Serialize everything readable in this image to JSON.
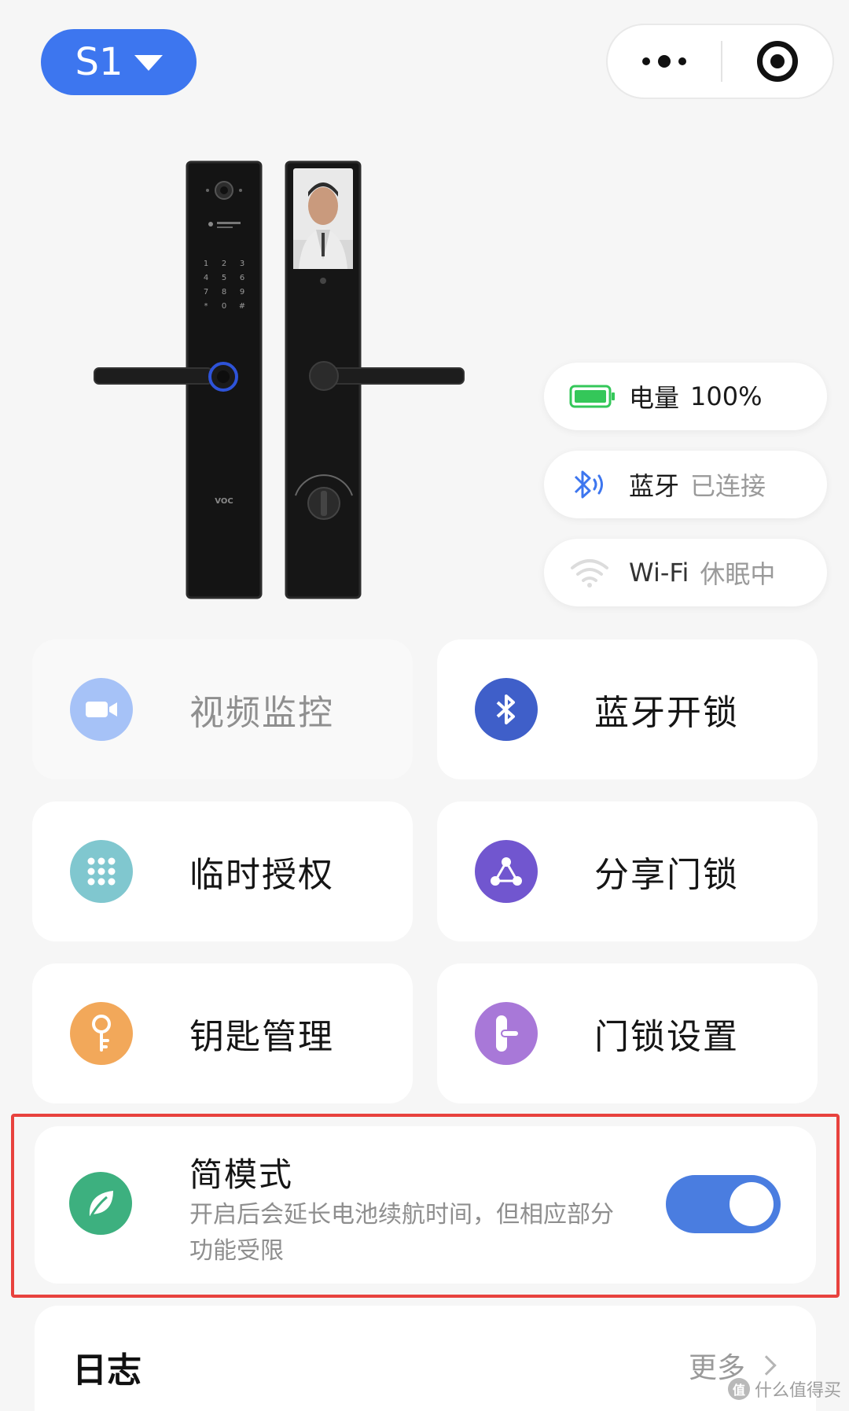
{
  "header": {
    "device_name": "S1"
  },
  "status": {
    "battery": {
      "label": "电量",
      "value": "100%"
    },
    "bluetooth": {
      "label": "蓝牙",
      "value": "已连接"
    },
    "wifi": {
      "label": "Wi-Fi",
      "value": "休眠中"
    }
  },
  "actions": [
    {
      "label": "视频监控",
      "icon": "video-camera-icon",
      "color": "#a6c2f7",
      "enabled": false
    },
    {
      "label": "蓝牙开锁",
      "icon": "bluetooth-icon",
      "color": "#3f5fc9",
      "enabled": true
    },
    {
      "label": "临时授权",
      "icon": "keypad-icon",
      "color": "#80c7cf",
      "enabled": true
    },
    {
      "label": "分享门锁",
      "icon": "share-icon",
      "color": "#7156cf",
      "enabled": true
    },
    {
      "label": "钥匙管理",
      "icon": "key-icon",
      "color": "#f2a85a",
      "enabled": true
    },
    {
      "label": "门锁设置",
      "icon": "lock-settings-icon",
      "color": "#a878d8",
      "enabled": true
    }
  ],
  "simple_mode": {
    "title": "简模式",
    "description": "开启后会延长电池续航时间，但相应部分功能受限",
    "enabled": true
  },
  "log": {
    "title": "日志",
    "more_label": "更多"
  },
  "lock_image": {
    "brand_text": "VOC"
  },
  "watermark": {
    "badge": "值",
    "text": "什么值得买"
  },
  "colors": {
    "accent": "#3d76ef",
    "toggle_on": "#4a7de0",
    "highlight": "#e8423e",
    "battery": "#34c759"
  }
}
